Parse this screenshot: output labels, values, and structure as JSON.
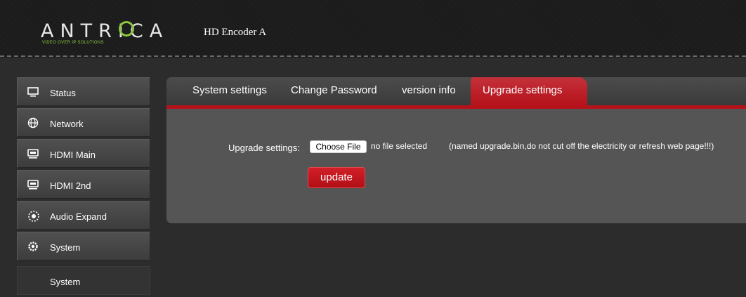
{
  "header": {
    "logo_text": "ANTRICA",
    "logo_tagline": "VIDEO OVER IP SOLUTIONS",
    "device_name": "HD Encoder A"
  },
  "sidebar": {
    "items": [
      {
        "label": "Status",
        "icon": "monitor-icon"
      },
      {
        "label": "Network",
        "icon": "globe-icon"
      },
      {
        "label": "HDMI Main",
        "icon": "hdmi-icon"
      },
      {
        "label": "HDMI 2nd",
        "icon": "hdmi-icon"
      },
      {
        "label": "Audio Expand",
        "icon": "audio-icon"
      },
      {
        "label": "System",
        "icon": "gear-icon"
      }
    ],
    "sub_item": "System"
  },
  "tabs": [
    {
      "label": "System settings"
    },
    {
      "label": "Change Password"
    },
    {
      "label": "version info"
    },
    {
      "label": "Upgrade settings",
      "active": true
    }
  ],
  "upgrade": {
    "label": "Upgrade settings:",
    "choose_file": "Choose File",
    "file_status": "no file selected",
    "note": "(named upgrade.bin,do not cut off the electricity or refresh web page!!!)",
    "update_button": "update"
  },
  "colors": {
    "accent": "#b5121b",
    "logo_green": "#8cc63f"
  }
}
